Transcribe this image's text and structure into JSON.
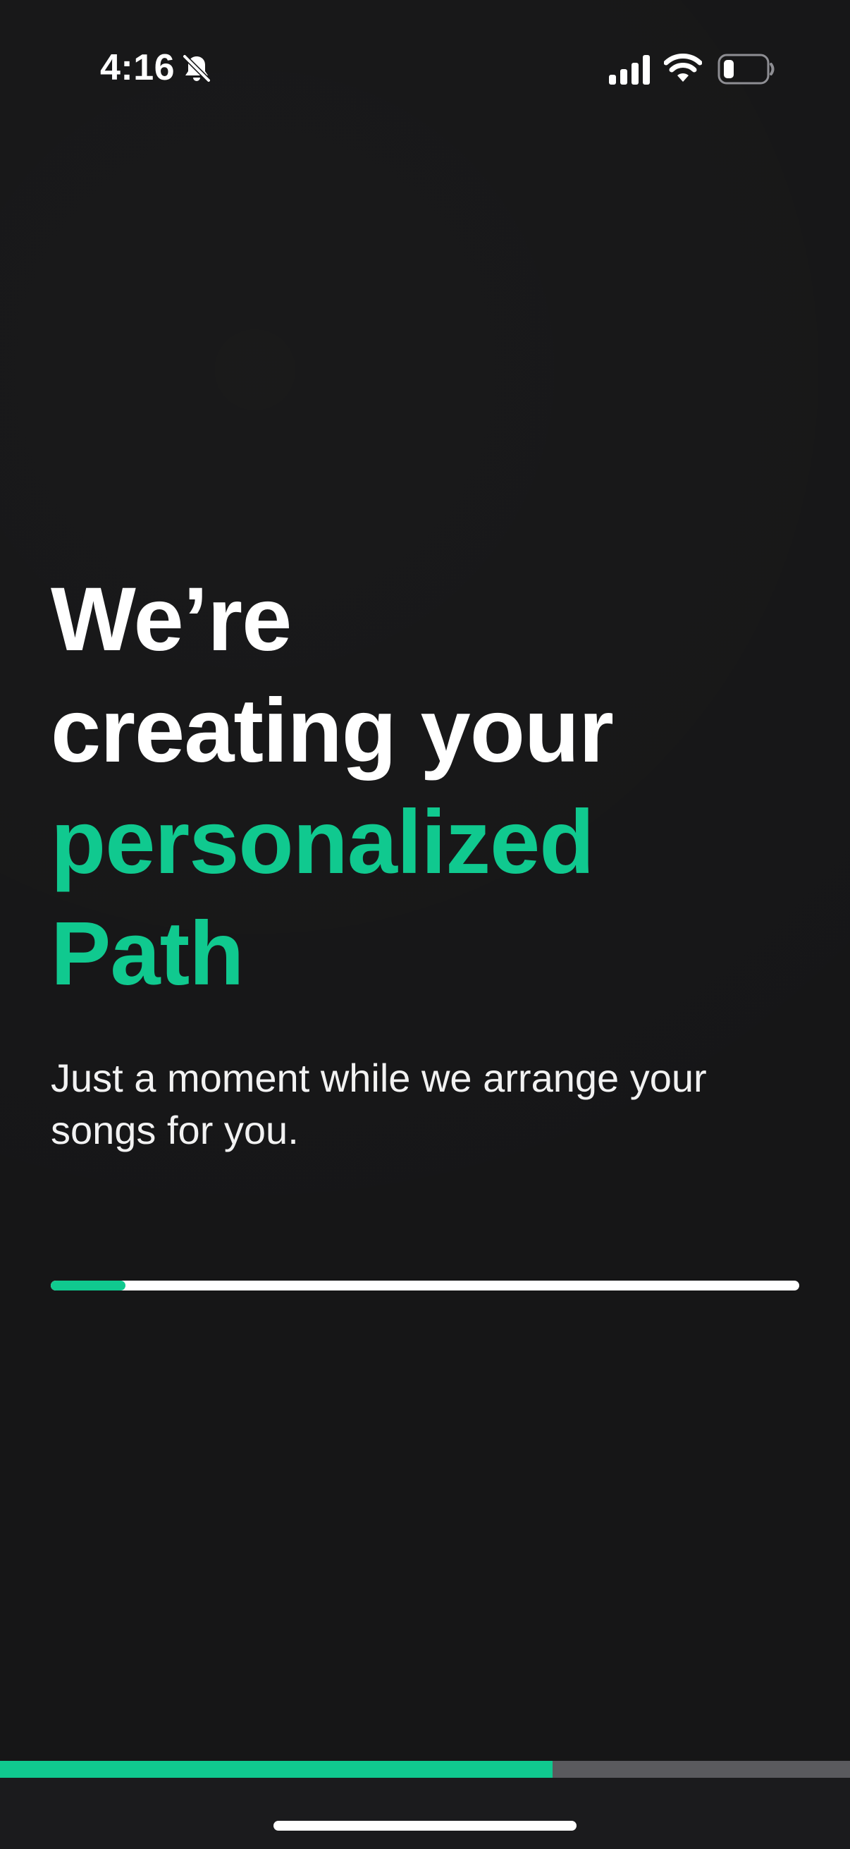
{
  "status_bar": {
    "time": "4:16",
    "icons": [
      "bell-slash-icon",
      "cellular-signal-icon",
      "wifi-icon",
      "battery-icon"
    ]
  },
  "headline": {
    "line1": "We’re",
    "line2": "creating your",
    "line3": "personalized",
    "line4": "Path"
  },
  "subtitle": "Just a moment while we arrange your songs for you.",
  "loading_progress": 0.1,
  "onboarding_step_progress": 0.65,
  "colors": {
    "background": "#161617",
    "accent": "#10c98f",
    "text": "#ffffff",
    "track_remaining": "#5a5a5e"
  }
}
